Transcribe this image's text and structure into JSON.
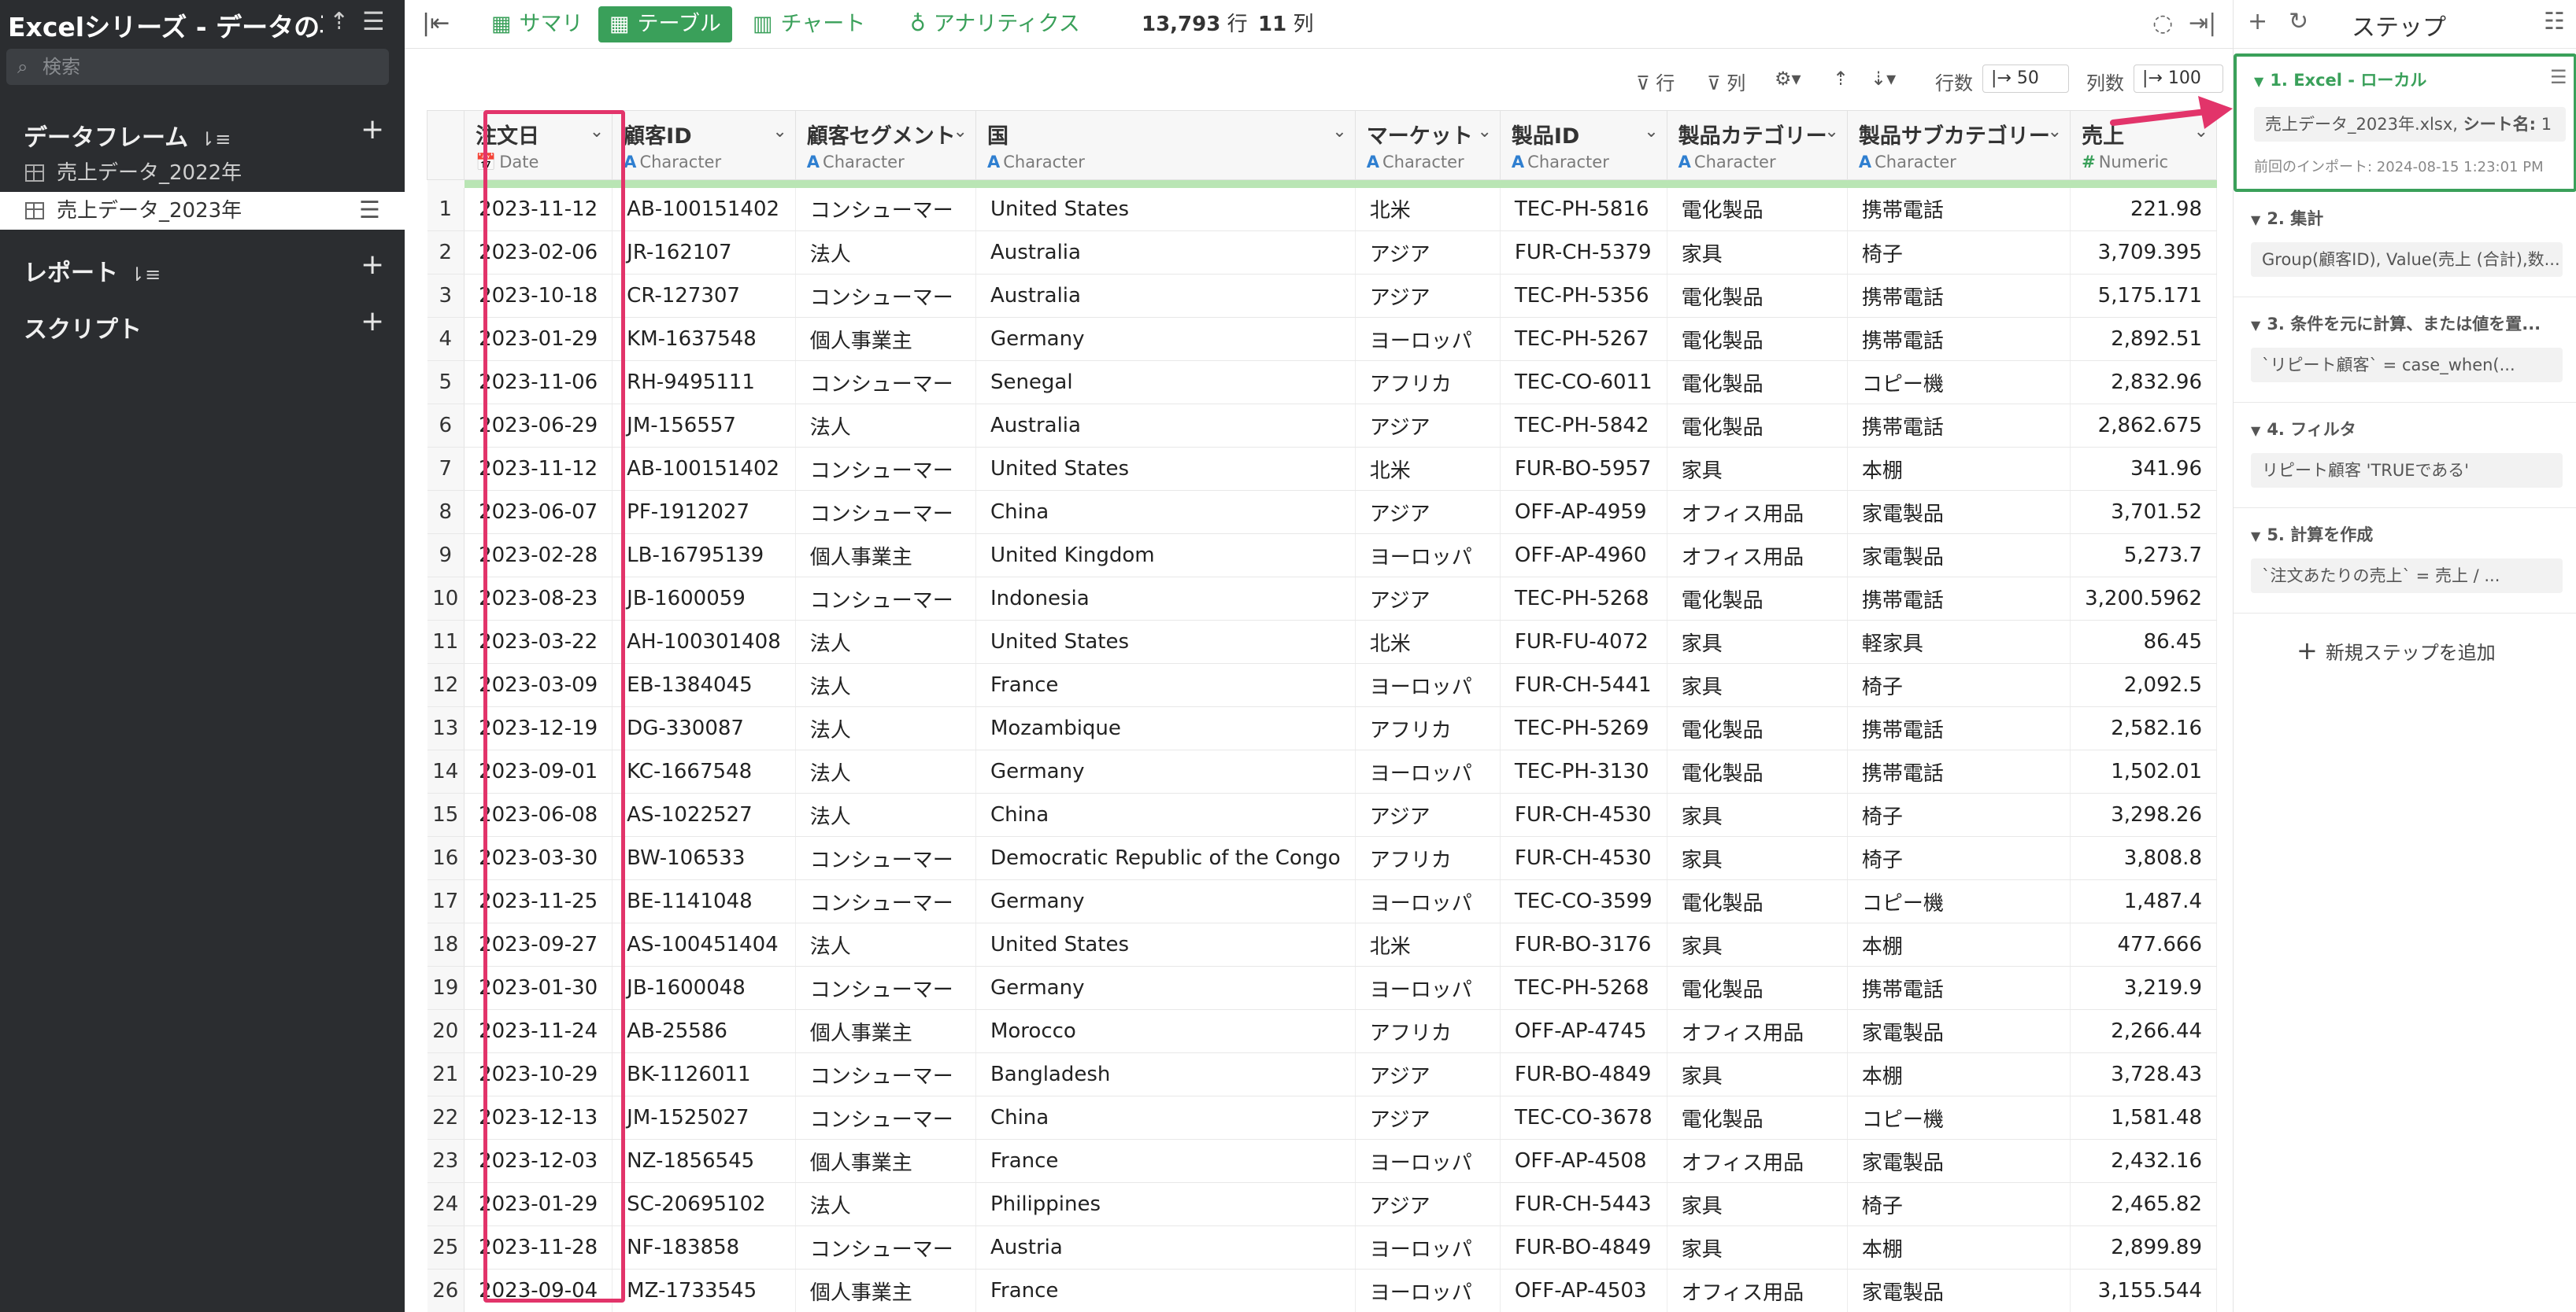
{
  "sidebar": {
    "project_title": "Excelシリーズ - データの再...",
    "search_placeholder": "検索",
    "sections": {
      "dataframes": "データフレーム",
      "reports": "レポート",
      "scripts": "スクリプト"
    },
    "dataframes": [
      {
        "label": "売上データ_2022年",
        "active": false
      },
      {
        "label": "売上データ_2023年",
        "active": true
      }
    ]
  },
  "toolbar": {
    "summary": "サマリ",
    "table": "テーブル",
    "chart": "チャート",
    "analytics": "アナリティクス",
    "row_count": "13,793",
    "row_unit": "行",
    "col_count": "11",
    "col_unit": "列"
  },
  "controls": {
    "row_filter": "行",
    "col_filter": "列",
    "rows_label": "行数",
    "rows_value": "50",
    "cols_label": "列数",
    "cols_value": "100"
  },
  "table": {
    "columns": [
      {
        "name": "注文日",
        "type": "Date",
        "glyph": "📅"
      },
      {
        "name": "顧客ID",
        "type": "Character",
        "glyph": "A"
      },
      {
        "name": "顧客セグメント",
        "type": "Character",
        "glyph": "A"
      },
      {
        "name": "国",
        "type": "Character",
        "glyph": "A"
      },
      {
        "name": "マーケット",
        "type": "Character",
        "glyph": "A"
      },
      {
        "name": "製品ID",
        "type": "Character",
        "glyph": "A"
      },
      {
        "name": "製品カテゴリー",
        "type": "Character",
        "glyph": "A"
      },
      {
        "name": "製品サブカテゴリー",
        "type": "Character",
        "glyph": "A"
      },
      {
        "name": "売上",
        "type": "Numeric",
        "glyph": "#"
      }
    ],
    "rows": [
      [
        "2023-11-12",
        "AB-100151402",
        "コンシューマー",
        "United States",
        "北米",
        "TEC-PH-5816",
        "電化製品",
        "携帯電話",
        "221.98"
      ],
      [
        "2023-02-06",
        "JR-162107",
        "法人",
        "Australia",
        "アジア",
        "FUR-CH-5379",
        "家具",
        "椅子",
        "3,709.395"
      ],
      [
        "2023-10-18",
        "CR-127307",
        "コンシューマー",
        "Australia",
        "アジア",
        "TEC-PH-5356",
        "電化製品",
        "携帯電話",
        "5,175.171"
      ],
      [
        "2023-01-29",
        "KM-1637548",
        "個人事業主",
        "Germany",
        "ヨーロッパ",
        "TEC-PH-5267",
        "電化製品",
        "携帯電話",
        "2,892.51"
      ],
      [
        "2023-11-06",
        "RH-9495111",
        "コンシューマー",
        "Senegal",
        "アフリカ",
        "TEC-CO-6011",
        "電化製品",
        "コピー機",
        "2,832.96"
      ],
      [
        "2023-06-29",
        "JM-156557",
        "法人",
        "Australia",
        "アジア",
        "TEC-PH-5842",
        "電化製品",
        "携帯電話",
        "2,862.675"
      ],
      [
        "2023-11-12",
        "AB-100151402",
        "コンシューマー",
        "United States",
        "北米",
        "FUR-BO-5957",
        "家具",
        "本棚",
        "341.96"
      ],
      [
        "2023-06-07",
        "PF-1912027",
        "コンシューマー",
        "China",
        "アジア",
        "OFF-AP-4959",
        "オフィス用品",
        "家電製品",
        "3,701.52"
      ],
      [
        "2023-02-28",
        "LB-16795139",
        "個人事業主",
        "United Kingdom",
        "ヨーロッパ",
        "OFF-AP-4960",
        "オフィス用品",
        "家電製品",
        "5,273.7"
      ],
      [
        "2023-08-23",
        "JB-1600059",
        "コンシューマー",
        "Indonesia",
        "アジア",
        "TEC-PH-5268",
        "電化製品",
        "携帯電話",
        "3,200.5962"
      ],
      [
        "2023-03-22",
        "AH-100301408",
        "法人",
        "United States",
        "北米",
        "FUR-FU-4072",
        "家具",
        "軽家具",
        "86.45"
      ],
      [
        "2023-03-09",
        "EB-1384045",
        "法人",
        "France",
        "ヨーロッパ",
        "FUR-CH-5441",
        "家具",
        "椅子",
        "2,092.5"
      ],
      [
        "2023-12-19",
        "DG-330087",
        "法人",
        "Mozambique",
        "アフリカ",
        "TEC-PH-5269",
        "電化製品",
        "携帯電話",
        "2,582.16"
      ],
      [
        "2023-09-01",
        "KC-1667548",
        "法人",
        "Germany",
        "ヨーロッパ",
        "TEC-PH-3130",
        "電化製品",
        "携帯電話",
        "1,502.01"
      ],
      [
        "2023-06-08",
        "AS-1022527",
        "法人",
        "China",
        "アジア",
        "FUR-CH-4530",
        "家具",
        "椅子",
        "3,298.26"
      ],
      [
        "2023-03-30",
        "BW-106533",
        "コンシューマー",
        "Democratic Republic of the Congo",
        "アフリカ",
        "FUR-CH-4530",
        "家具",
        "椅子",
        "3,808.8"
      ],
      [
        "2023-11-25",
        "BE-1141048",
        "コンシューマー",
        "Germany",
        "ヨーロッパ",
        "TEC-CO-3599",
        "電化製品",
        "コピー機",
        "1,487.4"
      ],
      [
        "2023-09-27",
        "AS-100451404",
        "法人",
        "United States",
        "北米",
        "FUR-BO-3176",
        "家具",
        "本棚",
        "477.666"
      ],
      [
        "2023-01-30",
        "JB-1600048",
        "コンシューマー",
        "Germany",
        "ヨーロッパ",
        "TEC-PH-5268",
        "電化製品",
        "携帯電話",
        "3,219.9"
      ],
      [
        "2023-11-24",
        "AB-25586",
        "個人事業主",
        "Morocco",
        "アフリカ",
        "OFF-AP-4745",
        "オフィス用品",
        "家電製品",
        "2,266.44"
      ],
      [
        "2023-10-29",
        "BK-1126011",
        "コンシューマー",
        "Bangladesh",
        "アジア",
        "FUR-BO-4849",
        "家具",
        "本棚",
        "3,728.43"
      ],
      [
        "2023-12-13",
        "JM-1525027",
        "コンシューマー",
        "China",
        "アジア",
        "TEC-CO-3678",
        "電化製品",
        "コピー機",
        "1,581.48"
      ],
      [
        "2023-12-03",
        "NZ-1856545",
        "個人事業主",
        "France",
        "ヨーロッパ",
        "OFF-AP-4508",
        "オフィス用品",
        "家電製品",
        "2,432.16"
      ],
      [
        "2023-01-29",
        "SC-20695102",
        "法人",
        "Philippines",
        "アジア",
        "FUR-CH-5443",
        "家具",
        "椅子",
        "2,465.82"
      ],
      [
        "2023-11-28",
        "NF-183858",
        "コンシューマー",
        "Austria",
        "ヨーロッパ",
        "FUR-BO-4849",
        "家具",
        "本棚",
        "2,899.89"
      ],
      [
        "2023-09-04",
        "MZ-1733545",
        "個人事業主",
        "France",
        "ヨーロッパ",
        "OFF-AP-4503",
        "オフィス用品",
        "家電製品",
        "3,155.544"
      ]
    ]
  },
  "steps": {
    "title": "ステップ",
    "items": [
      {
        "head": "1. Excel - ローカル",
        "box_file": "売上データ_2023年.xlsx,",
        "box_sheet_label": "シート名:",
        "box_sheet_value": "1",
        "meta": "前回のインポート: 2024-08-15 1:23:01 PM"
      },
      {
        "head": "2. 集計",
        "box": "Group(顧客ID), Value(売上 (合計),数..."
      },
      {
        "head": "3. 条件を元に計算、または値を置...",
        "box": "`リピート顧客` = case_when(..."
      },
      {
        "head": "4. フィルタ",
        "box": "リピート顧客 'TRUEである'"
      },
      {
        "head": "5. 計算を作成",
        "box": "`注文あたりの売上` = 売上 / ..."
      }
    ],
    "add_label": "新規ステップを追加"
  },
  "colors": {
    "accent_green": "#3aa05a",
    "highlight_pink": "#e2346a",
    "sidebar_bg": "#2b2d30"
  }
}
